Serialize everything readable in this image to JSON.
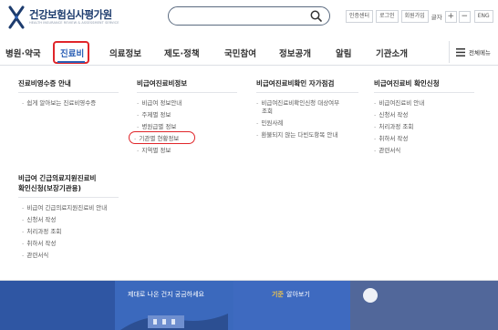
{
  "header": {
    "logo_title": "건강보험심사평가원",
    "logo_sub": "HEALTH INSURANCE REVIEW & ASSESSMENT SERVICE",
    "search_placeholder": "",
    "util_links": [
      "인증센터",
      "로그인",
      "회원가입"
    ],
    "font_label": "글자",
    "font_plus": "+",
    "font_minus": "−",
    "lang": "ENG"
  },
  "nav": {
    "items": [
      "병원·약국",
      "진료비",
      "의료정보",
      "제도·정책",
      "국민참여",
      "정보공개",
      "알림",
      "기관소개"
    ],
    "active_index": 1,
    "all_menu": "전체메뉴"
  },
  "menu": {
    "col1": {
      "title": "진료비영수증 안내",
      "links": [
        "쉽게 알아보는 진료비영수증"
      ]
    },
    "col2": {
      "title": "비급여진료비정보",
      "links": [
        "비급여 정보안내",
        "주제별 정보",
        "병원급별 정보",
        "기관별 현황정보",
        "지역별 정보"
      ]
    },
    "col3": {
      "title": "비급여진료비확인 자가점검",
      "links": [
        "비급여진료비확인신청 대상여부",
        "조회",
        "민원사례",
        "환불되지 않는 다빈도항목 안내"
      ]
    },
    "col4": {
      "title": "비급여진료비 확인신청",
      "links": [
        "비급여진료비 안내",
        "신청서 작성",
        "처리과정 조회",
        "취하서 작성",
        "관련서식"
      ]
    },
    "col5": {
      "title_line1": "비급여 긴급의료지원진료비",
      "title_line2": "확인신청(보장기관용)",
      "links": [
        "비급여 긴급의료지원진료비 안내",
        "신청서 작성",
        "처리과정 조회",
        "취하서 작성",
        "관련서식"
      ]
    }
  },
  "banner": {
    "text_left": "제대로 나온 건지 궁금하세요",
    "text_mid_yellow": "기준",
    "text_mid": "알아보기"
  },
  "colors": {
    "brand_blue": "#1d3c6e",
    "accent_blue": "#2a5fb5",
    "highlight_red": "#e0252a",
    "banner_blue": "#3c66b8"
  }
}
